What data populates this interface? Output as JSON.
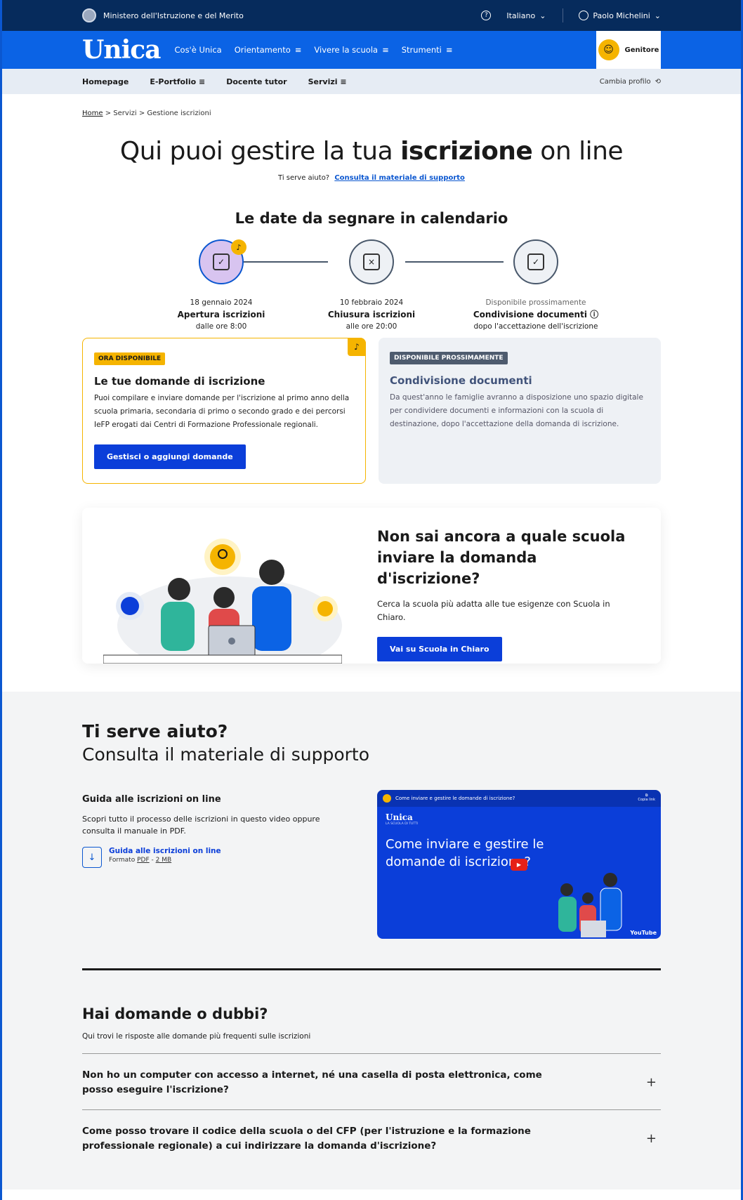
{
  "topbar": {
    "ministry": "Ministero dell'Istruzione e del Merito",
    "help_icon": "question-circle-icon",
    "language": "Italiano",
    "user_name": "Paolo Michelini"
  },
  "brand": {
    "logo": "Unica",
    "nav": [
      {
        "label": "Cos'è Unica",
        "menu": ""
      },
      {
        "label": "Orientamento",
        "menu": "≡"
      },
      {
        "label": "Vivere la scuola",
        "menu": "≡"
      },
      {
        "label": "Strumenti",
        "menu": "≡"
      }
    ],
    "profile_label": "Genitore"
  },
  "subnav": {
    "items": [
      {
        "label": "Homepage",
        "menu": ""
      },
      {
        "label": "E-Portfolio",
        "menu": "≡"
      },
      {
        "label": "Docente tutor",
        "menu": ""
      },
      {
        "label": "Servizi",
        "menu": "≡"
      }
    ],
    "switch_profile": "Cambia profilo"
  },
  "breadcrumb": {
    "home": "Home",
    "sep1": ">",
    "servizi": "Servizi",
    "sep2": ">",
    "current": "Gestione iscrizioni"
  },
  "hero": {
    "title_pre": "Qui puoi gestire la tua ",
    "title_bold": "iscrizione",
    "title_post": " on line",
    "help_text": "Ti serve aiuto?",
    "help_link": "Consulta il materiale di supporto"
  },
  "calendar": {
    "title": "Le date da segnare in calendario",
    "steps": [
      {
        "date": "18 gennaio 2024",
        "title": "Apertura iscrizioni",
        "note": "dalle ore 8:00",
        "icon": "calendar-check-icon",
        "active": true
      },
      {
        "date": "10 febbraio 2024",
        "title": "Chiusura iscrizioni",
        "note": "alle ore 20:00",
        "icon": "calendar-close-icon",
        "active": false
      },
      {
        "date": "Disponibile prossimamente",
        "title": "Condivisione documenti",
        "note": "dopo l'accettazione dell'iscrizione",
        "icon": "clipboard-check-icon",
        "active": false
      }
    ]
  },
  "cards": {
    "open": {
      "badge": "ORA DISPONIBILE",
      "title": "Le tue domande di iscrizione",
      "text": "Puoi compilare e inviare domande per l'iscrizione al primo anno della scuola primaria, secondaria di primo o secondo grado e dei percorsi IeFP erogati dai Centri di Formazione Professionale regionali.",
      "button": "Gestisci o aggiungi domande"
    },
    "soon": {
      "badge": "DISPONIBILE PROSSIMAMENTE",
      "title": "Condivisione documenti",
      "text": "Da quest'anno le famiglie avranno a disposizione uno spazio digitale per condividere documenti e informazioni con la scuola di destinazione, dopo l'accettazione della domanda di iscrizione."
    }
  },
  "promo": {
    "title": "Non sai ancora a quale scuola inviare la domanda d'iscrizione?",
    "text": "Cerca la scuola più adatta alle tue esigenze con Scuola in Chiaro.",
    "button": "Vai su Scuola in Chiaro"
  },
  "support": {
    "title": "Ti serve aiuto?",
    "subtitle": "Consulta il materiale di supporto",
    "guide_title": "Guida alle iscrizioni on line",
    "guide_text": "Scopri tutto il processo delle iscrizioni in questo video oppure consulta il manuale in PDF.",
    "download_label": "Guida alle iscrizioni on line",
    "download_format_pre": "Formato ",
    "download_format": "PDF",
    "download_sep": " - ",
    "download_size": "2 MB",
    "video": {
      "top_title": "Come inviare e gestire le domande di iscrizione?",
      "copy_label": "Copia link",
      "logo": "Unica",
      "logo_sub": "LA SCUOLA DI TUTTI",
      "title": "Come inviare e gestire le domande di iscrizione?",
      "yt_label": "YouTube"
    }
  },
  "faq": {
    "title": "Hai domande o dubbi?",
    "subtitle": "Qui trovi le risposte alle domande più frequenti sulle iscrizioni",
    "items": [
      {
        "q": "Non ho un computer con accesso a internet, né una casella di posta elettronica, come posso eseguire l'iscrizione?"
      },
      {
        "q": "Come posso trovare il codice della scuola o del CFP (per l'istruzione e la formazione professionale regionale) a cui indirizzare la domanda d'iscrizione?"
      }
    ]
  },
  "colors": {
    "primary": "#0b63e5",
    "dark_blue": "#062b5c",
    "button_blue": "#0b3ed9",
    "yellow": "#f5b400"
  }
}
